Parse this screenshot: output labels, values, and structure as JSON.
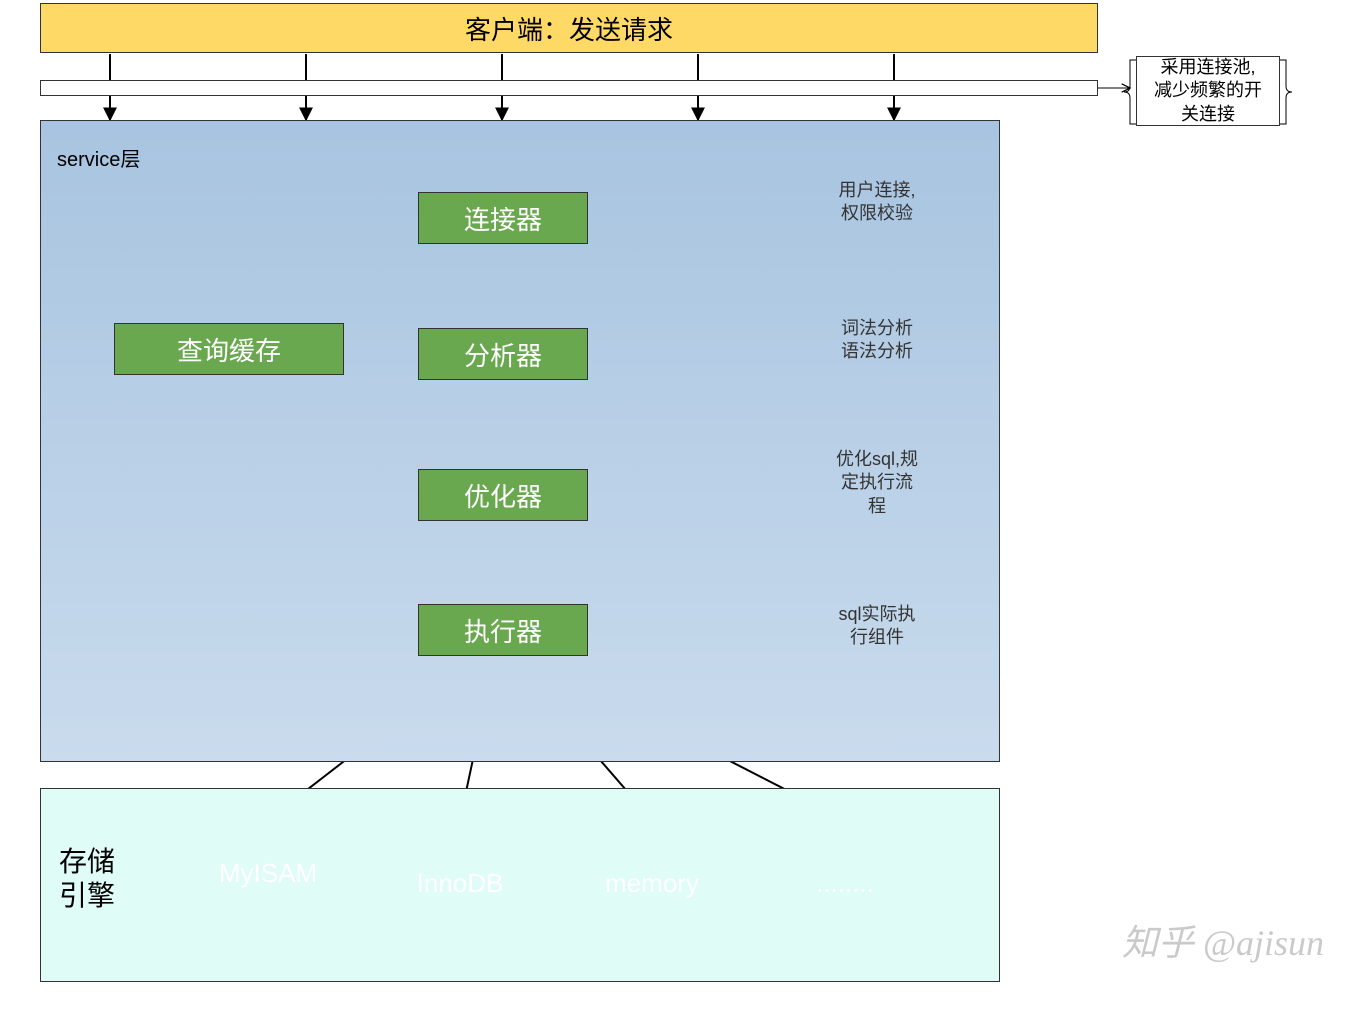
{
  "client": {
    "label": "客户端：发送请求"
  },
  "callout": {
    "line1": "采用连接池,",
    "line2": "减少频繁的开",
    "line3": "关连接"
  },
  "service": {
    "label": "service层",
    "connector": "连接器",
    "cache": "查询缓存",
    "analyzer": "分析器",
    "optimizer": "优化器",
    "executor": "执行器"
  },
  "clouds": {
    "c1l1": "用户连接,",
    "c1l2": "权限校验",
    "c2l1": "词法分析",
    "c2l2": "语法分析",
    "c3l1": "优化sql,规",
    "c3l2": "定执行流",
    "c3l3": "程",
    "c4l1": "sql实际执",
    "c4l2": "行组件"
  },
  "storage": {
    "label_l1": "存储",
    "label_l2": "引擎",
    "db1": "MyISAM",
    "db2": "InnoDB",
    "db3": "memory",
    "db4": "........"
  },
  "watermark": "知乎 @ajisun"
}
